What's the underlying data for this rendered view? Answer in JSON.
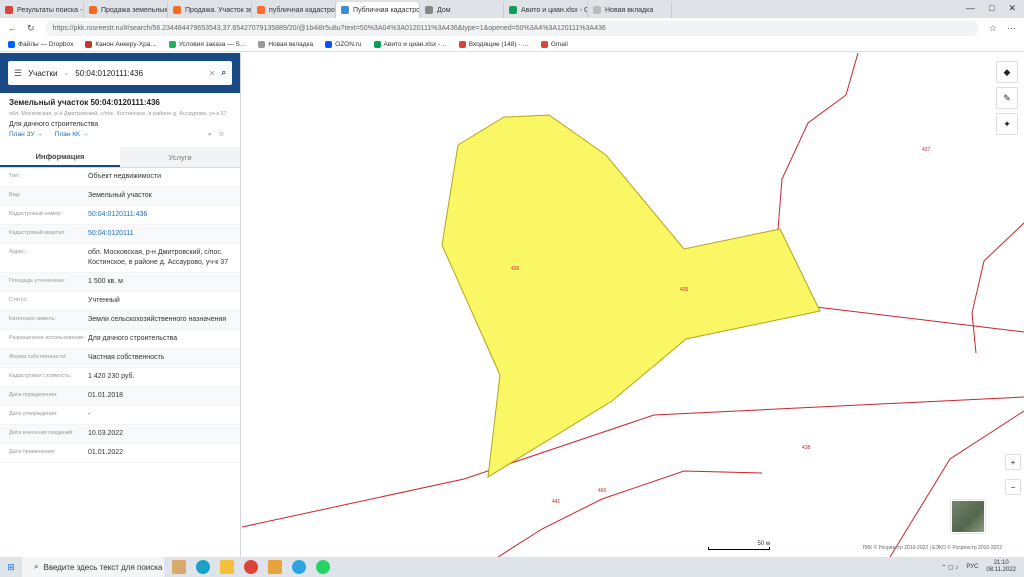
{
  "browser": {
    "tabs": [
      {
        "label": "Результаты поиска - mar…",
        "color": "#d44638"
      },
      {
        "label": "Продажа земельных уча…",
        "color": "#f36b21"
      },
      {
        "label": "Продажа. Участок земел…",
        "color": "#f36b21"
      },
      {
        "label": "публичная кадастровая…",
        "color": "#ff6d2e"
      },
      {
        "label": "Публичная кадастровая…",
        "color": "#3c8dd5"
      },
      {
        "label": "Дом",
        "color": "#888888"
      },
      {
        "label": "Авито и циан.xlsx - Goog…",
        "color": "#0f9d58"
      },
      {
        "label": "Новая вкладка",
        "color": "#bbbbbb"
      }
    ],
    "controls": [
      "—",
      "□",
      "✕"
    ],
    "url": "https://pkk.rosreestr.ru/#/search/56.234484479653543,37.65427079135889/20/@1b4i8r5u8u?text=50%3A04%3A0120111%3A436&type=1&opened=50%3A4%3A120111%3A436",
    "bookmarks": [
      {
        "label": "Файлы — Dropbox",
        "color": "#0061fe"
      },
      {
        "label": "Канон Анкеру-Хра…",
        "color": "#c0392b"
      },
      {
        "label": "Условия заказа — S…",
        "color": "#27ae60"
      },
      {
        "label": "Новая вкладка",
        "color": "#999999"
      },
      {
        "label": "OZON.ru",
        "color": "#0055ff"
      },
      {
        "label": "Авито и циан.xlsx -…",
        "color": "#0f9d58"
      },
      {
        "label": "Входящие (148) - …",
        "color": "#d44638"
      },
      {
        "label": "Gmail",
        "color": "#d44638"
      }
    ]
  },
  "search": {
    "category": "Участки",
    "query": "50:04:0120111:436"
  },
  "parcel": {
    "title": "Земельный участок 50:04:0120111:436",
    "address_short": "обл. Московская, р-н Дмитровский, с/пос. Костинское, в районе д. Ассаурово, уч-к 37",
    "purpose": "Для дачного строительства",
    "link_left": "План ЗУ →",
    "link_right": "План КК →"
  },
  "panel_tabs": {
    "info": "Информация",
    "services": "Услуги"
  },
  "rows": [
    {
      "label": "Тип:",
      "value": "Объект недвижимости"
    },
    {
      "label": "Вид:",
      "value": "Земельный участок"
    },
    {
      "label": "Кадастровый номер:",
      "value": "50:04:0120111:436"
    },
    {
      "label": "Кадастровый квартал:",
      "value": "50:04:0120111"
    },
    {
      "label": "Адрес:",
      "value": "обл. Московская, р-н Дмитровский, с/пос. Костинское, в районе д. Ассаурово, уч-к 37"
    },
    {
      "label": "Площадь уточненная:",
      "value": "1 500 кв. м"
    },
    {
      "label": "Статус:",
      "value": "Учтенный"
    },
    {
      "label": "Категория земель:",
      "value": "Земли сельскохозяйственного назначения"
    },
    {
      "label": "Разрешенное использование:",
      "value": "Для дачного строительства"
    },
    {
      "label": "Форма собственности:",
      "value": "Частная собственность"
    },
    {
      "label": "Кадастровая стоимость:",
      "value": "1 420 230 руб."
    },
    {
      "label": "Дата определения:",
      "value": "01.01.2018"
    },
    {
      "label": "Дата утверждения:",
      "value": "-"
    },
    {
      "label": "Дата внесения сведений:",
      "value": "10.03.2022"
    },
    {
      "label": "Дата применения:",
      "value": "01.01.2022"
    }
  ],
  "map": {
    "labels": [
      "436",
      "435",
      "437",
      "438",
      "460",
      "441"
    ],
    "scale": "50 м",
    "copyright": "ПКК © Росреестр 2010-2022 | ЕЭКО © Росреестр 2010-2022",
    "parcel_fill": "#f9f764",
    "boundary": "#c6262c"
  },
  "taskbar": {
    "search_placeholder": "Введите здесь текст для поиска",
    "lang": "РУС",
    "time": "21:10",
    "date": "08.11.2022"
  }
}
